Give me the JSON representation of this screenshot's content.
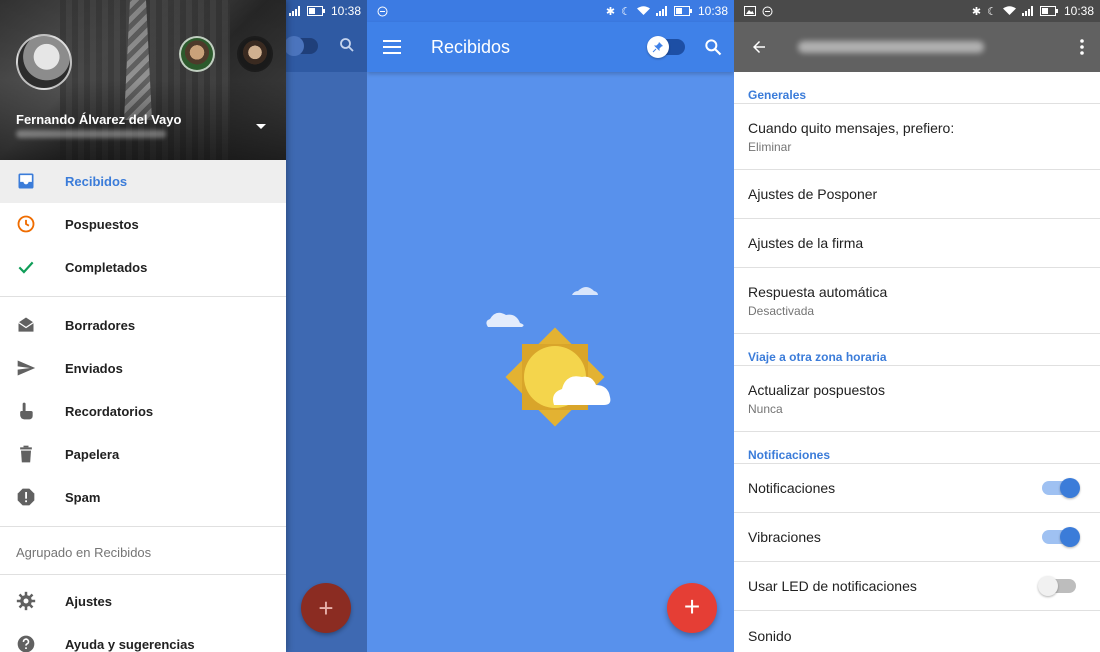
{
  "status_bar": {
    "time": "10:38"
  },
  "drawer": {
    "account_name": "Fernando Álvarez del Vayo",
    "items": [
      {
        "label": "Recibidos",
        "icon": "inbox-icon",
        "color": "#3b7cd9"
      },
      {
        "label": "Pospuestos",
        "icon": "clock-icon",
        "color": "#ef6c00"
      },
      {
        "label": "Completados",
        "icon": "check-icon",
        "color": "#0f9d58"
      },
      {
        "label": "Borradores",
        "icon": "drafts-icon",
        "color": "#616161"
      },
      {
        "label": "Enviados",
        "icon": "send-icon",
        "color": "#616161"
      },
      {
        "label": "Recordatorios",
        "icon": "reminder-hand-icon",
        "color": "#616161"
      },
      {
        "label": "Papelera",
        "icon": "trash-icon",
        "color": "#616161"
      },
      {
        "label": "Spam",
        "icon": "spam-icon",
        "color": "#616161"
      }
    ],
    "section_label": "Agrupado en Recibidos",
    "footer_items": [
      {
        "label": "Ajustes",
        "icon": "gear-icon"
      },
      {
        "label": "Ayuda y sugerencias",
        "icon": "help-icon"
      }
    ]
  },
  "inbox": {
    "title": "Recibidos",
    "fab_label": "+",
    "colors": {
      "appbar": "#3f81e8",
      "background": "#5891ec",
      "fab": "#e53e35"
    }
  },
  "settings": {
    "sections": [
      {
        "header": "Generales",
        "items": [
          {
            "title": "Cuando quito mensajes, prefiero:",
            "subtitle": "Eliminar"
          },
          {
            "title": "Ajustes de Posponer"
          },
          {
            "title": "Ajustes de la firma"
          },
          {
            "title": "Respuesta automática",
            "subtitle": "Desactivada"
          }
        ]
      },
      {
        "header": "Viaje a otra zona horaria",
        "items": [
          {
            "title": "Actualizar pospuestos",
            "subtitle": "Nunca"
          }
        ]
      },
      {
        "header": "Notificaciones",
        "items": [
          {
            "title": "Notificaciones",
            "toggle": true
          },
          {
            "title": "Vibraciones",
            "toggle": true
          },
          {
            "title": "Usar LED de notificaciones",
            "toggle": false
          },
          {
            "title": "Sonido"
          }
        ]
      }
    ]
  }
}
